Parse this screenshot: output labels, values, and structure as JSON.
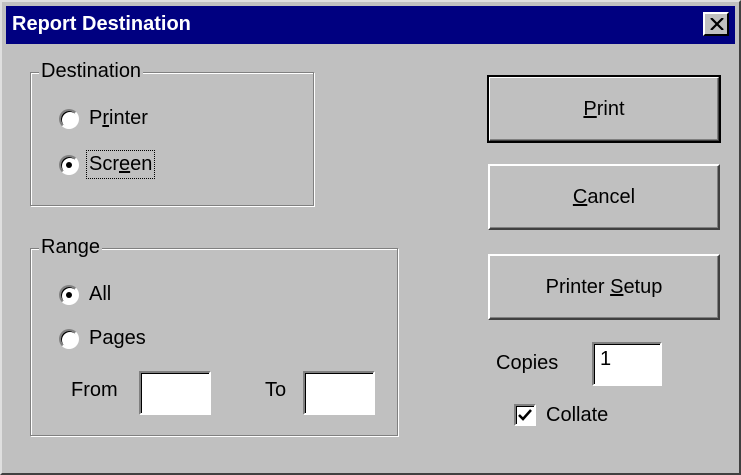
{
  "window": {
    "title": "Report Destination"
  },
  "destination": {
    "legend": "Destination",
    "options": [
      {
        "pre": "P",
        "key": "r",
        "post": "inter",
        "selected": false
      },
      {
        "pre": "Scr",
        "key": "e",
        "post": "en",
        "selected": true
      }
    ]
  },
  "range": {
    "legend": "Range",
    "options": [
      {
        "label": "All",
        "selected": true
      },
      {
        "label": "Pages",
        "selected": false
      }
    ],
    "from_label": "From",
    "from_value": "",
    "to_label": "To",
    "to_value": ""
  },
  "buttons": {
    "print": {
      "key": "P",
      "rest": "rint"
    },
    "cancel": {
      "key": "C",
      "rest": "ancel"
    },
    "setup": {
      "pre": "Printer ",
      "key": "S",
      "rest": "etup"
    }
  },
  "copies": {
    "label": "Copies",
    "value": "1"
  },
  "collate": {
    "label": "Collate",
    "checked": true
  }
}
